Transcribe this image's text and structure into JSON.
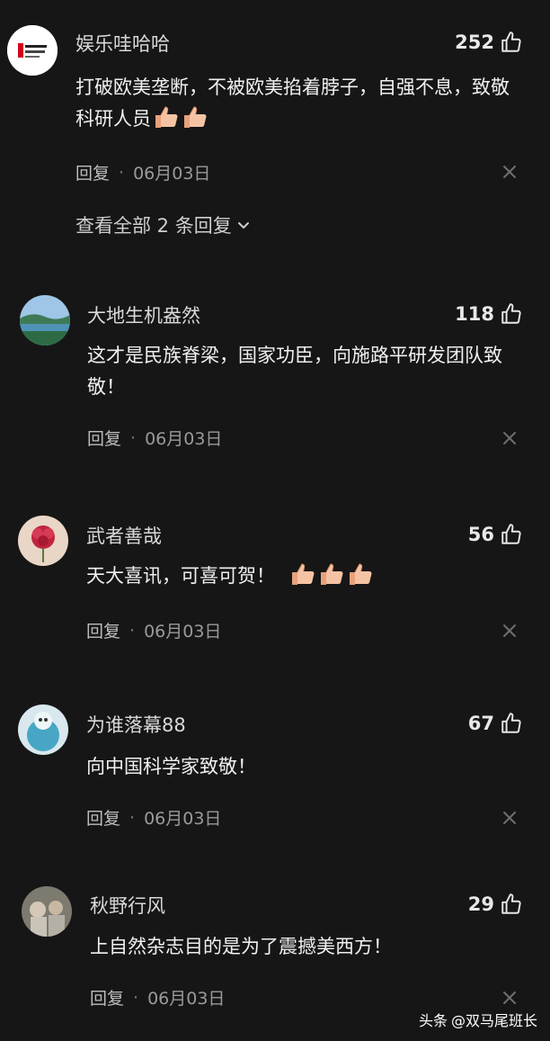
{
  "comments": [
    {
      "username": "娱乐哇哈哈",
      "likes": "252",
      "content": "打破欧美垄断，不被欧美掐着脖子，自强不息，致敬科研人员",
      "emoji_count": 2,
      "reply_label": "回复",
      "date": "06月03日",
      "view_replies": "查看全部 2 条回复"
    },
    {
      "username": "大地生机盎然",
      "likes": "118",
      "content": "这才是民族脊梁，国家功臣，向施路平研发团队致敬！",
      "emoji_count": 0,
      "reply_label": "回复",
      "date": "06月03日"
    },
    {
      "username": "武者善哉",
      "likes": "56",
      "content": "天大喜讯，可喜可贺！",
      "emoji_count": 3,
      "reply_label": "回复",
      "date": "06月03日"
    },
    {
      "username": "为谁落幕88",
      "likes": "67",
      "content": "向中国科学家致敬！",
      "emoji_count": 0,
      "reply_label": "回复",
      "date": "06月03日"
    },
    {
      "username": "秋野行风",
      "likes": "29",
      "content": "上自然杂志目的是为了震撼美西方！",
      "emoji_count": 0,
      "reply_label": "回复",
      "date": "06月03日"
    }
  ],
  "icons": {
    "like": "thumbs-up-outline-icon",
    "close": "close-x-icon",
    "chevron": "chevron-down-icon",
    "emoji": "thumbs-up-emoji"
  },
  "watermark": {
    "brand": "头条",
    "account": "@双马尾班长"
  },
  "colors": {
    "background": "#161616",
    "text": "#f0f0f0",
    "muted": "#9a9a9a"
  }
}
